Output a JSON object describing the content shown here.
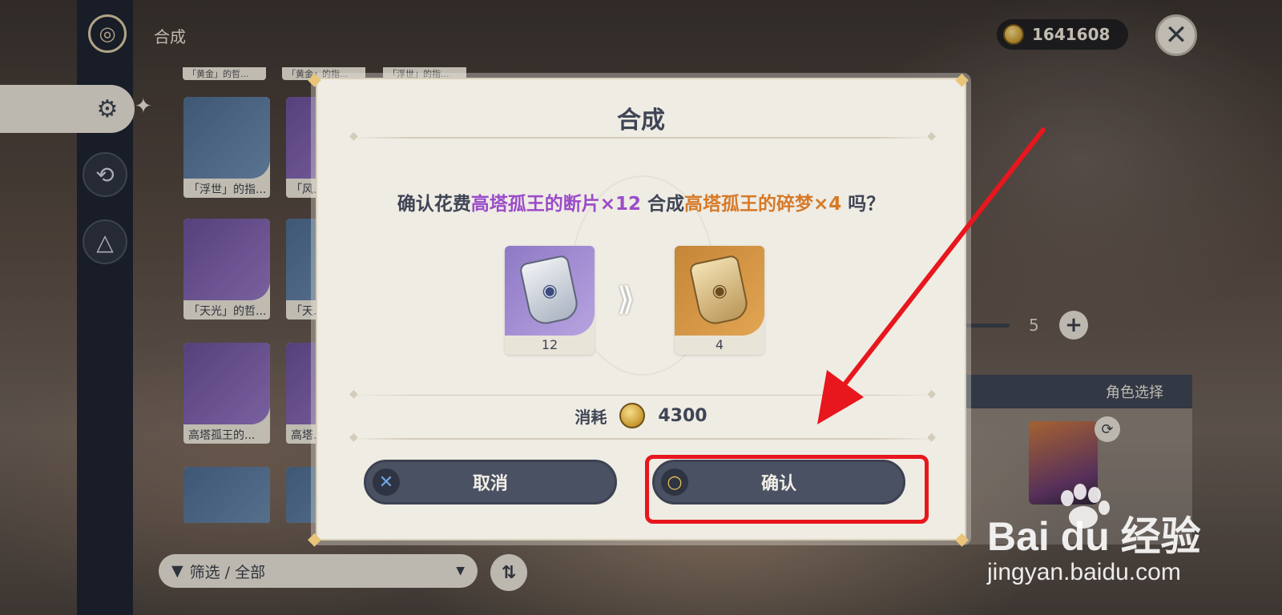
{
  "header": {
    "title": "合成",
    "currency_amount": "1641608"
  },
  "grid": {
    "top_tags": [
      "「黄金」的哲...",
      "「黄金」的指...",
      "「浮世」的指..."
    ],
    "items": [
      {
        "label": "「浮世」的指..."
      },
      {
        "label": "「风..."
      },
      {
        "label": "「天光」的哲..."
      },
      {
        "label": "「天..."
      },
      {
        "label": "高塔孤王的..."
      },
      {
        "label": "高塔..."
      }
    ]
  },
  "filter": {
    "label": "筛选 / 全部"
  },
  "right_panel": {
    "quantity": "5",
    "character_header": "角色选择"
  },
  "watermark": {
    "line1": "Bai du 经验",
    "line2": "jingyan.baidu.com"
  },
  "modal": {
    "title": "合成",
    "message_prefix": "确认花费",
    "message_source": "高塔孤王的断片×12",
    "message_mid": " 合成",
    "message_target": "高塔孤王的碎梦×4",
    "message_suffix": " 吗？",
    "source_count": "12",
    "target_count": "4",
    "cost_label": "消耗",
    "cost_value": "4300",
    "cancel_label": "取消",
    "confirm_label": "确认"
  },
  "colors": {
    "highlight": "#e8161d",
    "source_text": "#9b4cc8",
    "target_text": "#d67a28"
  }
}
